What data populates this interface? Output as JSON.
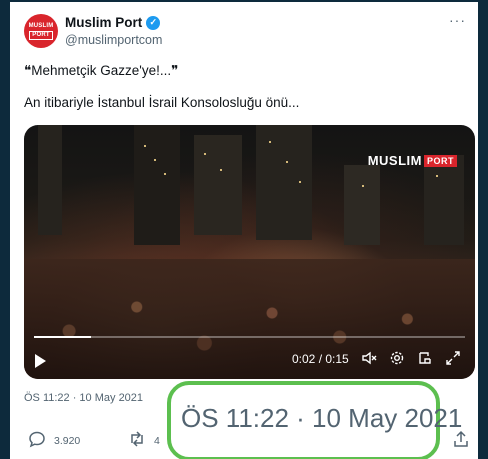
{
  "tweet": {
    "avatar_text": "MUSLIM",
    "avatar_sub": "PORT",
    "name": "Muslim Port",
    "handle": "@muslimportcom",
    "more": "···",
    "line1": "❝Mehmetçik Gazze'ye!...❞",
    "line2": "An itibariyle İstanbul İsrail Konsolosluğu önü...",
    "timestamp": "ÖS 11:22 · 10 May 2021",
    "reply_count": "3.920",
    "retweet_count": "4"
  },
  "video": {
    "watermark_main": "MUSLIM",
    "watermark_port": "PORT",
    "time": "0:02 / 0:15",
    "progress": 0.133
  },
  "zoom": {
    "text": "ÖS 11:22 · 10 May 2021",
    "border_color": "#5cbf4f"
  },
  "colors": {
    "verified": "#1d9bf0",
    "brand": "#d9252c",
    "secondary_text": "#536471"
  },
  "icons": [
    "verified-icon",
    "more-icon",
    "play-icon",
    "volume-off-icon",
    "settings-icon",
    "pip-icon",
    "fullscreen-icon",
    "reply-icon",
    "retweet-icon",
    "share-icon"
  ]
}
